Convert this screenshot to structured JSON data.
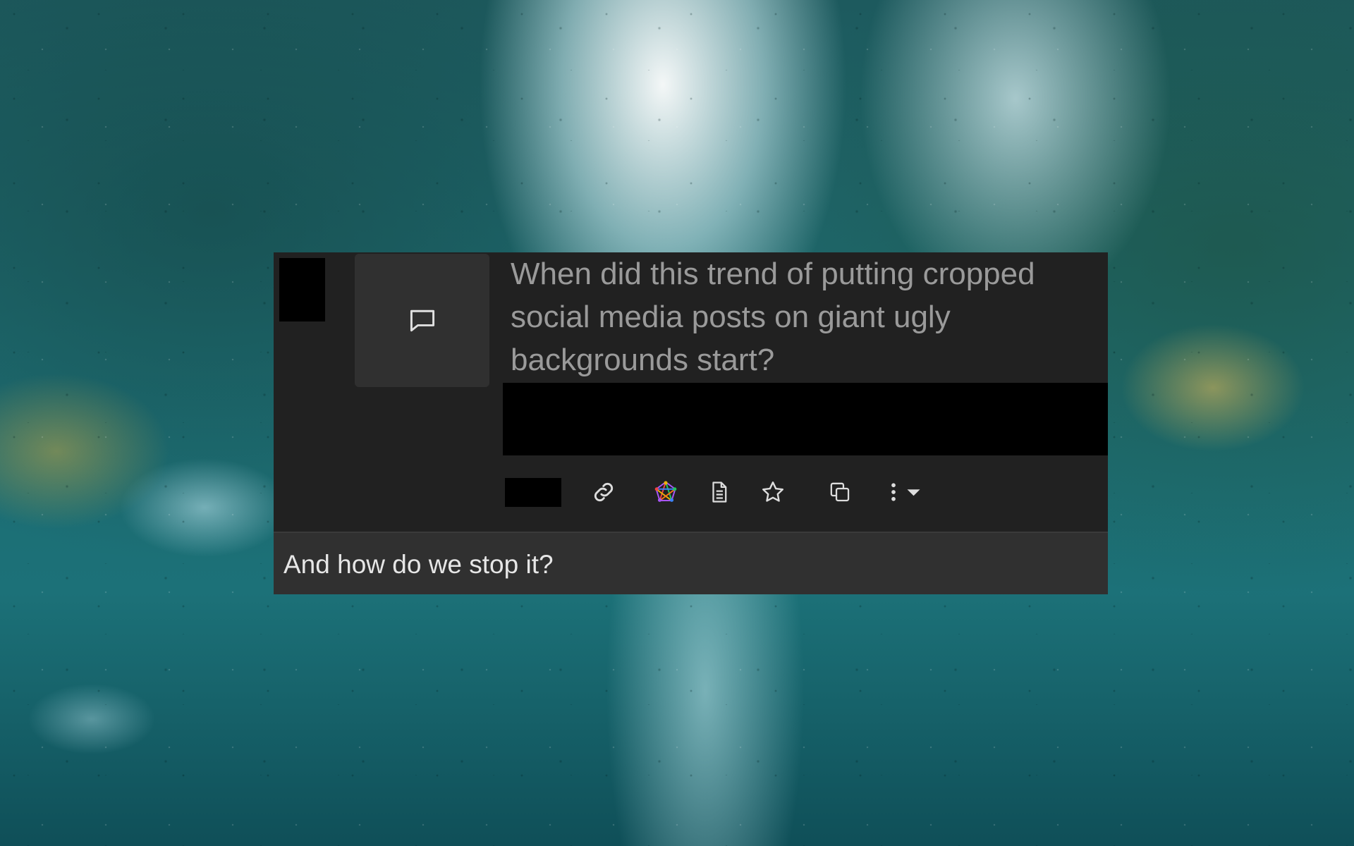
{
  "post": {
    "title": "When did this trend of putting cropped social media posts on giant ugly backgrounds start?",
    "body": "And how do we stop it?"
  },
  "icons": {
    "thumbnail": "speech-bubble-icon",
    "actions": [
      "link-icon",
      "fediverse-icon",
      "document-icon",
      "star-icon",
      "copy-icon",
      "more-options-icon"
    ]
  },
  "colors": {
    "card_background": "#212121",
    "thumbnail_background": "#303030",
    "body_background": "#303030",
    "title_text": "#9a9a9a",
    "body_text": "#e6e6e6",
    "icon": "#dddddd"
  }
}
